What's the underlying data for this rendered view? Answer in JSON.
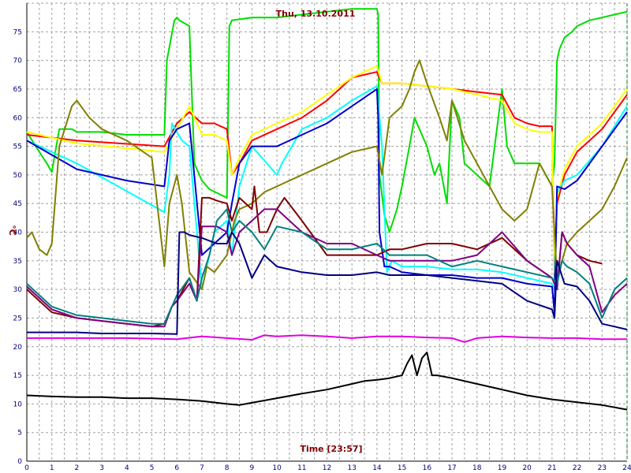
{
  "chart_data": {
    "type": "line",
    "title": "Thu, 13.10.2011",
    "xlabel": "Time [23:57]",
    "ylabel": "°C",
    "xlim": [
      0,
      24
    ],
    "ylim": [
      0,
      80
    ],
    "grid": true,
    "x_ticks": [
      "0",
      "1",
      "2",
      "3",
      "4",
      "5",
      "6",
      "7",
      "8",
      "9",
      "10",
      "11",
      "12",
      "13",
      "14",
      "15",
      "16",
      "17",
      "18",
      "19",
      "20",
      "21",
      "22",
      "23",
      "24"
    ],
    "y_ticks": [
      "0",
      "5",
      "10",
      "15",
      "20",
      "25",
      "30",
      "35",
      "40",
      "45",
      "50",
      "55",
      "60",
      "65",
      "70",
      "75"
    ],
    "colors": {
      "background": "#ffffff",
      "grid": "#a0a0a0",
      "axis": "#000000",
      "cursor": "#008000",
      "text_tick": "#000080",
      "text_label": "#800000"
    },
    "series": [
      {
        "color": "#00dd00",
        "x": [
          0,
          0.5,
          0.8,
          1,
          1.3,
          1.8,
          2,
          3,
          4,
          5.5,
          5.6,
          5.9,
          6,
          6.1,
          6.5,
          6.7,
          7,
          7.3,
          8,
          8.1,
          8.2,
          9,
          10,
          11,
          12,
          13,
          14,
          14.05,
          14.1,
          14.3,
          14.5,
          14.8,
          15,
          15.3,
          15.5,
          16,
          16.3,
          16.5,
          16.8,
          17,
          17.3,
          17.5,
          18,
          18.5,
          19,
          19.2,
          19.5,
          20,
          20.5,
          21,
          21.1,
          21.2,
          21.3,
          21.5,
          21.8,
          22,
          22.5,
          23,
          23.5,
          24
        ],
        "y": [
          57.5,
          54,
          52,
          50.5,
          58,
          58,
          57.5,
          57.5,
          57,
          57,
          70,
          77,
          77.5,
          77,
          76,
          52,
          49,
          47.5,
          46,
          76,
          77,
          77.5,
          77.5,
          78,
          78.5,
          79,
          79,
          78,
          50,
          43,
          40,
          44,
          48,
          55,
          60,
          55,
          50,
          52,
          45,
          63,
          60,
          52,
          50,
          48,
          65,
          55,
          52,
          52,
          52,
          48,
          52,
          70,
          72,
          74,
          75,
          76,
          77,
          77.5,
          78,
          78.5
        ]
      },
      {
        "color": "#ff0000",
        "x": [
          0,
          2,
          5.5,
          6,
          6.5,
          7,
          7.5,
          8,
          8.2,
          8.5,
          9,
          10,
          11,
          12,
          13,
          14,
          14.2,
          15,
          16,
          17,
          18,
          19,
          19.5,
          20,
          20.5,
          21,
          21.1,
          21.2,
          21.5,
          22,
          23,
          24
        ],
        "y": [
          57,
          56,
          55,
          59,
          61,
          59,
          59,
          58,
          50,
          52,
          56,
          58,
          60,
          63,
          67,
          68,
          66,
          66,
          65.5,
          65,
          64.5,
          64,
          60,
          59,
          58.5,
          58.5,
          32,
          45,
          50,
          54,
          58,
          64
        ]
      },
      {
        "color": "#ffff00",
        "x": [
          0,
          2,
          5.5,
          6,
          6.5,
          7,
          7.5,
          8,
          8.2,
          8.5,
          9,
          10,
          11,
          12,
          13,
          14,
          14.2,
          15,
          16,
          17,
          18,
          19,
          19.5,
          20,
          20.5,
          21,
          21.1,
          21.2,
          21.5,
          22,
          23,
          24
        ],
        "y": [
          57.5,
          55.5,
          54,
          58,
          62,
          57,
          57,
          56,
          50,
          53,
          57,
          59,
          61,
          64,
          67,
          69,
          66,
          66,
          65.5,
          65,
          64,
          63,
          59,
          58,
          57.5,
          57.5,
          33,
          46,
          51,
          55,
          59,
          65
        ]
      },
      {
        "color": "#00ffff",
        "x": [
          0,
          2,
          5.5,
          5.7,
          5.8,
          6.2,
          6.5,
          7,
          7.5,
          8,
          8.2,
          8.5,
          9,
          10,
          10.2,
          11,
          12,
          13,
          14,
          14.2,
          14.4,
          14.6,
          15,
          16,
          17,
          18,
          19,
          20,
          21,
          21.1,
          21.2,
          21.5,
          22,
          23,
          24
        ],
        "y": [
          56,
          52,
          43.5,
          50,
          59,
          56,
          55,
          30,
          40,
          42,
          36,
          48,
          55,
          50,
          52,
          58,
          60,
          63,
          65.5,
          55,
          33,
          35,
          34,
          34,
          33.5,
          33.5,
          33,
          32,
          31,
          30,
          47,
          49,
          50,
          55,
          62
        ]
      },
      {
        "color": "#0000cd",
        "x": [
          0,
          1,
          2,
          3,
          4,
          5.5,
          5.7,
          6,
          6.5,
          7,
          7.5,
          8,
          8.2,
          8.5,
          9,
          10,
          11,
          12,
          13,
          14,
          14.05,
          14.1,
          14.3,
          14.5,
          15,
          16,
          17,
          18,
          19,
          20,
          21,
          21.1,
          21.2,
          21.5,
          22,
          23,
          24
        ],
        "y": [
          56,
          53.5,
          51,
          50,
          49,
          48,
          56,
          58,
          59,
          36,
          38,
          40,
          45,
          52,
          55,
          55,
          57,
          59,
          62,
          65,
          60,
          40,
          34,
          34,
          33,
          32.5,
          32.5,
          32,
          32,
          31,
          30.5,
          26,
          48,
          47.5,
          49,
          55,
          61
        ]
      },
      {
        "color": "#808000",
        "x": [
          0,
          0.2,
          0.5,
          0.8,
          1,
          1.3,
          1.8,
          2,
          2.5,
          3,
          4,
          5,
          5.5,
          5.7,
          6,
          6.2,
          6.5,
          7,
          7.2,
          7.5,
          8,
          8.3,
          8.5,
          9,
          9.5,
          10,
          11,
          12,
          13,
          14,
          14.2,
          14.5,
          15,
          15.3,
          15.5,
          15.7,
          16,
          16.5,
          16.8,
          17,
          17.5,
          18,
          18.5,
          19,
          19.5,
          20,
          20.5,
          21,
          21.2,
          21.4,
          21.6,
          22,
          22.5,
          23,
          23.5,
          24
        ],
        "y": [
          39,
          40,
          37,
          36,
          38,
          55,
          62,
          63,
          60,
          58,
          56,
          53,
          34,
          45,
          50,
          45,
          33,
          30,
          34,
          33,
          36,
          42,
          44,
          45,
          47,
          48,
          50,
          52,
          54,
          55,
          50,
          60,
          62,
          65,
          68,
          70,
          66,
          60,
          56,
          63,
          56,
          52,
          48,
          44,
          42,
          44,
          52,
          48,
          32,
          35,
          38,
          40,
          42,
          44,
          48,
          53
        ]
      },
      {
        "color": "#800000",
        "x": [
          0,
          1,
          2,
          3,
          4,
          5,
          5.5,
          5.8,
          6,
          6.5,
          6.8,
          7,
          7.3,
          7.6,
          8,
          8.2,
          8.5,
          9,
          9.1,
          9.3,
          9.6,
          10,
          10.3,
          11,
          12,
          13,
          14,
          14.5,
          15,
          16,
          17,
          18,
          19,
          20,
          21,
          21.2,
          21.4,
          21.6,
          22,
          22.5,
          23
        ],
        "y": [
          30,
          26,
          25,
          24.5,
          24,
          23.5,
          24,
          27,
          28,
          32,
          28,
          46,
          46,
          45.5,
          45,
          42,
          46,
          44,
          48,
          40,
          40,
          44,
          46,
          42,
          36,
          36,
          36,
          37,
          37,
          38,
          38,
          37,
          39,
          35,
          32,
          30,
          40,
          38,
          36,
          35,
          34.5
        ]
      },
      {
        "color": "#800080",
        "x": [
          0,
          1,
          2,
          3,
          4,
          5,
          5.5,
          5.8,
          6,
          6.5,
          6.8,
          7,
          7.3,
          7.6,
          8,
          8.2,
          8.5,
          9,
          9.5,
          10,
          11,
          12,
          13,
          14,
          14.5,
          15,
          16,
          17,
          18,
          19,
          20,
          21,
          21.2,
          21.4,
          21.6,
          22,
          22.5,
          23,
          23.5,
          24
        ],
        "y": [
          30.5,
          26.5,
          25,
          24.5,
          24,
          23.5,
          23.5,
          27,
          28,
          31,
          28,
          41,
          41,
          41,
          40,
          36,
          40,
          42,
          44,
          44,
          40,
          38,
          38,
          36,
          35,
          35,
          35,
          35,
          36,
          40,
          35,
          32,
          30,
          40,
          38,
          36,
          34,
          26,
          29,
          31
        ]
      },
      {
        "color": "#008080",
        "x": [
          0,
          1,
          2,
          3,
          4,
          5,
          5.5,
          5.8,
          6,
          6.5,
          6.8,
          7,
          7.3,
          7.6,
          8,
          8.2,
          8.5,
          9,
          9.5,
          10,
          11,
          12,
          13,
          14,
          14.5,
          15,
          16,
          17,
          18,
          19,
          20,
          21,
          21.2,
          21.4,
          21.6,
          22,
          22.5,
          23,
          23.5,
          24
        ],
        "y": [
          31,
          27,
          25.5,
          25,
          24.5,
          24,
          24,
          27,
          29,
          32,
          28,
          32,
          36,
          42,
          44,
          40,
          42,
          40,
          37,
          41,
          40,
          37,
          37,
          38,
          36,
          36,
          36,
          34,
          35,
          34,
          33,
          32,
          31,
          35,
          34,
          33,
          31,
          25,
          30,
          32
        ]
      },
      {
        "color": "#000080",
        "x": [
          0,
          1,
          2,
          3,
          4,
          5,
          6,
          6.1,
          6.3,
          6.5,
          7,
          7.3,
          7.6,
          8,
          8.2,
          8.5,
          9,
          9.5,
          10,
          11,
          12,
          13,
          14,
          14.5,
          15,
          16,
          17,
          18,
          19,
          20,
          21,
          21.1,
          21.2,
          21.5,
          22,
          22.5,
          23,
          23.5,
          24
        ],
        "y": [
          22.5,
          22.5,
          22.5,
          22.3,
          22.3,
          22.3,
          22.2,
          40,
          40,
          39.5,
          39,
          38.5,
          38,
          38,
          40,
          38,
          32,
          36,
          34,
          33,
          32.5,
          32.5,
          33,
          32.5,
          32.5,
          32.5,
          32,
          31.5,
          31,
          28,
          26.5,
          25,
          35,
          31,
          30.5,
          28,
          24,
          23.5,
          23
        ]
      },
      {
        "color": "#e000e0",
        "x": [
          0,
          2,
          4,
          6,
          7,
          8,
          9,
          9.5,
          10,
          11,
          12,
          13,
          14,
          15,
          16,
          17,
          17.5,
          18,
          19,
          20,
          21,
          22,
          23,
          24
        ],
        "y": [
          21.5,
          21.5,
          21.5,
          21.3,
          21.8,
          21.5,
          21.2,
          22,
          21.8,
          22,
          21.8,
          21.5,
          21.8,
          21.8,
          21.6,
          21.5,
          20.8,
          21.5,
          21.8,
          21.6,
          21.5,
          21.5,
          21.3,
          21.3
        ]
      },
      {
        "color": "#000000",
        "x": [
          0,
          1,
          2,
          3,
          4,
          5,
          6,
          7,
          8,
          8.5,
          9,
          10,
          11,
          12,
          13,
          13.5,
          14,
          14.5,
          15,
          15.2,
          15.4,
          15.6,
          15.8,
          16,
          16.2,
          16.4,
          17,
          18,
          19,
          20,
          21,
          22,
          23,
          24
        ],
        "y": [
          11.5,
          11.3,
          11.2,
          11.2,
          11,
          11,
          10.8,
          10.5,
          10,
          9.8,
          10.2,
          11,
          11.8,
          12.5,
          13.5,
          14,
          14.2,
          14.5,
          15,
          17,
          18.5,
          15,
          18,
          19,
          15,
          15,
          14.5,
          13.5,
          12.5,
          11.5,
          10.8,
          10.3,
          9.8,
          9
        ]
      }
    ]
  }
}
